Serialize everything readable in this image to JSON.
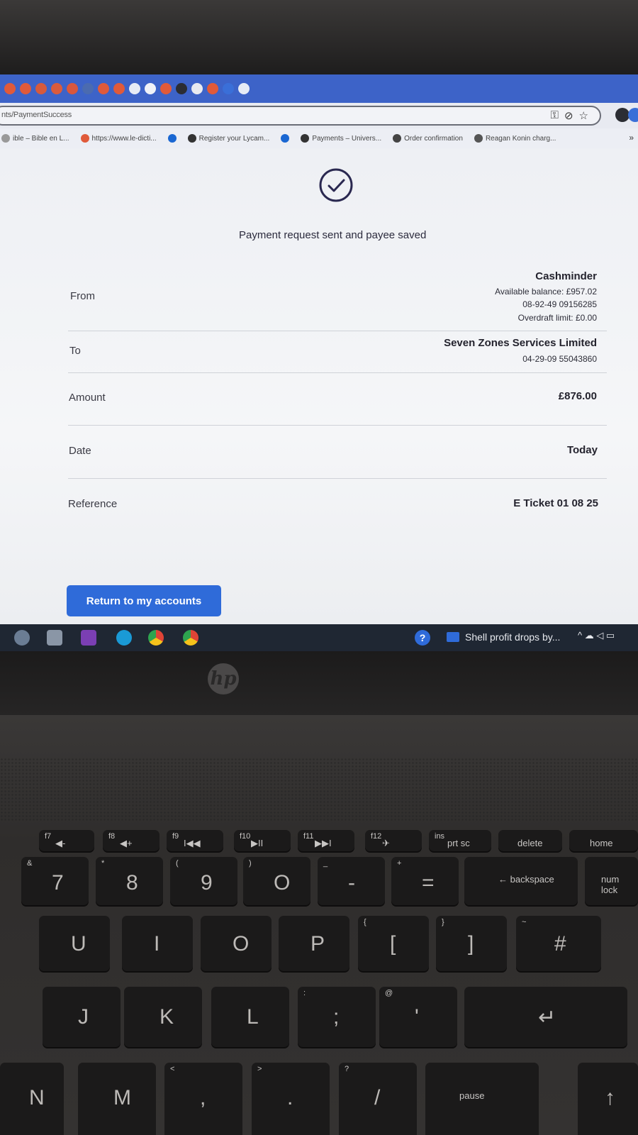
{
  "browser": {
    "address_text": "nts/PaymentSuccess",
    "tab_colors": [
      "#e05a3a",
      "#e05a3a",
      "#d65a3c",
      "#da5b3c",
      "#d9573d",
      "#4b6bb0",
      "#e05a3a",
      "#e05a3a",
      "#e6ebf5",
      "#f0f2f8",
      "#e05a3a",
      "#2b2d33",
      "#e8eaf0",
      "#e05a3a",
      "#3a6fd8",
      "#e6ebf5"
    ],
    "bookmarks": [
      {
        "label": "ible – Bible en L...",
        "icon_color": "#999"
      },
      {
        "label": "https://www.le-dicti...",
        "icon_color": "#e05a3a"
      },
      {
        "label": "",
        "icon_color": "#1a67d2"
      },
      {
        "label": "Register your Lycam...",
        "icon_color": "#333"
      },
      {
        "label": "",
        "icon_color": "#1a67d2"
      },
      {
        "label": "Payments – Univers...",
        "icon_color": "#333"
      },
      {
        "label": "Order confirmation",
        "icon_color": "#444"
      },
      {
        "label": "Reagan Konin charg...",
        "icon_color": "#555"
      }
    ],
    "more_label": "»",
    "addr_icons": [
      "key-icon",
      "eye-off-icon",
      "star-icon"
    ]
  },
  "page": {
    "success_message": "Payment request sent and payee saved",
    "from": {
      "label": "From",
      "account_name": "Cashminder",
      "available_balance": "Available balance: £957.02",
      "sort_account": "08-92-49 09156285",
      "overdraft": "Overdraft limit: £0.00"
    },
    "to": {
      "label": "To",
      "payee_name": "Seven Zones Services Limited",
      "sort_account": "04-29-09 55043860"
    },
    "amount": {
      "label": "Amount",
      "value": "£876.00"
    },
    "date": {
      "label": "Date",
      "value": "Today"
    },
    "reference": {
      "label": "Reference",
      "value": "E Ticket 01 08 25"
    },
    "return_button": "Return to my accounts",
    "accent_color": "#2f6bd9"
  },
  "taskbar": {
    "news_text": "Shell profit drops by...",
    "help_glyph": "?",
    "tray_glyphs": "^ ☁ ◁ ▭"
  },
  "laptop": {
    "brand": "hp"
  },
  "keyboard": {
    "keys": [
      {
        "id": "f7",
        "top": "f7",
        "main": "◀-"
      },
      {
        "id": "f8",
        "top": "f8",
        "main": "◀+"
      },
      {
        "id": "f9",
        "top": "f9",
        "main": "I◀◀"
      },
      {
        "id": "f10",
        "top": "f10",
        "main": "▶II"
      },
      {
        "id": "f11",
        "top": "f11",
        "main": "▶▶I"
      },
      {
        "id": "f12",
        "top": "f12",
        "main": "✈"
      },
      {
        "id": "prtsc",
        "top": "ins",
        "main": "prt sc"
      },
      {
        "id": "delete",
        "top": "",
        "main": "delete"
      },
      {
        "id": "home",
        "top": "",
        "main": "home"
      },
      {
        "id": "k7",
        "top": "&",
        "main": "7"
      },
      {
        "id": "k8",
        "top": "*",
        "main": "8"
      },
      {
        "id": "k9",
        "top": "(",
        "main": "9"
      },
      {
        "id": "k0",
        "top": ")",
        "main": "O"
      },
      {
        "id": "kminus",
        "top": "_",
        "main": "-"
      },
      {
        "id": "kequal",
        "top": "+",
        "main": "="
      },
      {
        "id": "backspace",
        "top": "",
        "main": "← backspace"
      },
      {
        "id": "numlock",
        "top": "",
        "main": "num lock"
      },
      {
        "id": "kU",
        "top": "",
        "main": "U"
      },
      {
        "id": "kI",
        "top": "",
        "main": "I"
      },
      {
        "id": "kO",
        "top": "",
        "main": "O"
      },
      {
        "id": "kP",
        "top": "",
        "main": "P"
      },
      {
        "id": "kbrace",
        "top": "{",
        "main": "["
      },
      {
        "id": "kbrace2",
        "top": "}",
        "main": "]"
      },
      {
        "id": "khash",
        "top": "~",
        "main": "#"
      },
      {
        "id": "kJ",
        "top": "",
        "main": "J"
      },
      {
        "id": "kK",
        "top": "",
        "main": "K"
      },
      {
        "id": "kL",
        "top": "",
        "main": "L"
      },
      {
        "id": "ksemi",
        "top": ":",
        "main": ";"
      },
      {
        "id": "kquote",
        "top": "@",
        "main": "'"
      },
      {
        "id": "enter",
        "top": "",
        "main": "↵"
      },
      {
        "id": "kN",
        "top": "",
        "main": "N"
      },
      {
        "id": "kM",
        "top": "",
        "main": "M"
      },
      {
        "id": "kcomma",
        "top": "<",
        "main": ","
      },
      {
        "id": "kperiod",
        "top": ">",
        "main": "."
      },
      {
        "id": "kslash",
        "top": "?",
        "main": "/"
      },
      {
        "id": "pause",
        "top": "",
        "main": "pause"
      },
      {
        "id": "up",
        "top": "",
        "main": "↑"
      }
    ]
  }
}
